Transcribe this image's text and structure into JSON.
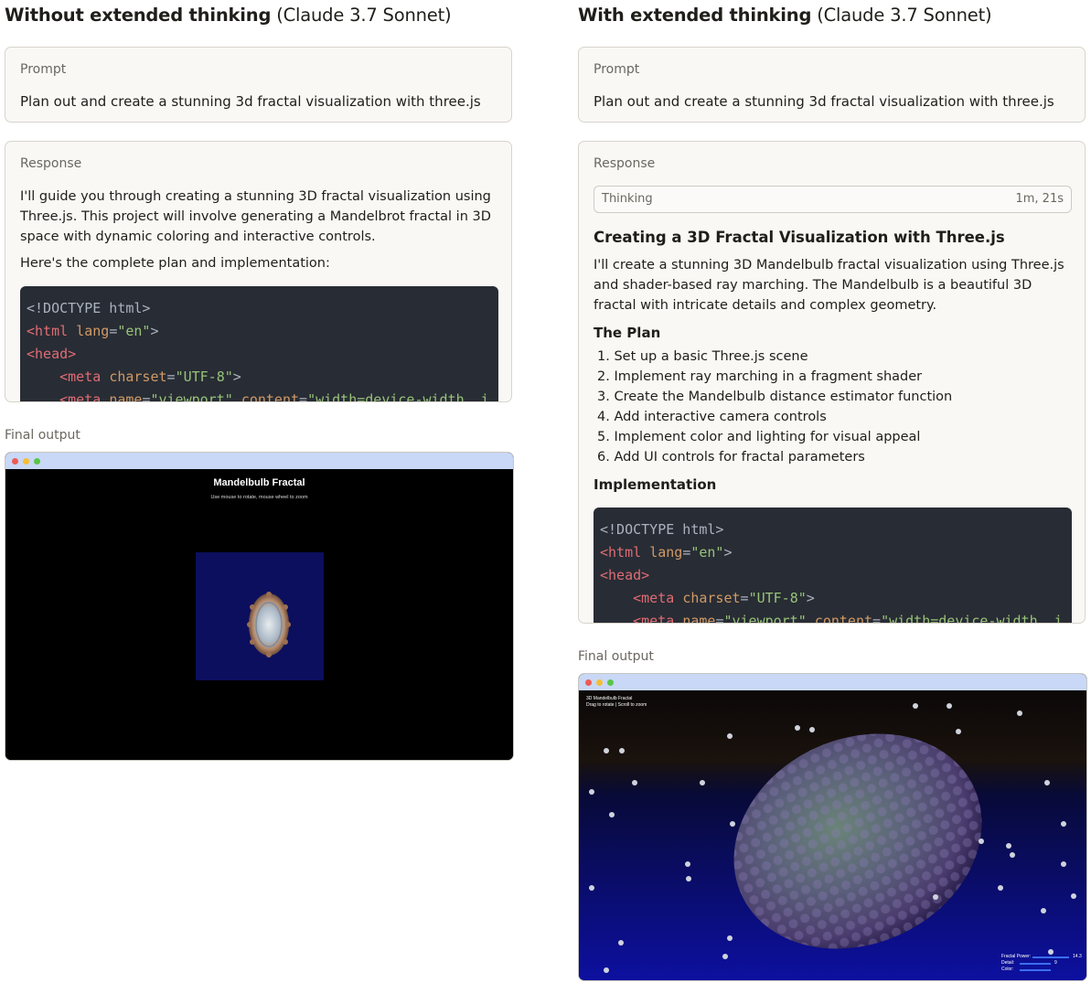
{
  "left": {
    "title_bold": "Without extended thinking",
    "title_sub": "(Claude 3.7 Sonnet)",
    "prompt_label": "Prompt",
    "prompt_text": "Plan out and create a stunning 3d fractal visualization with three.js",
    "response_label": "Response",
    "response_p1": "I'll guide you through creating a stunning 3D fractal visualization using Three.js. This project will involve generating a Mandelbrot fractal in 3D space with dynamic coloring and interactive controls.",
    "response_p2": "Here's the complete plan and implementation:",
    "final_label": "Final output",
    "render": {
      "title": "Mandelbulb Fractal",
      "subtitle": "Use mouse to rotate, mouse wheel to zoom"
    }
  },
  "right": {
    "title_bold": "With extended thinking",
    "title_sub": "(Claude 3.7 Sonnet)",
    "prompt_label": "Prompt",
    "prompt_text": "Plan out and create a stunning 3d fractal visualization with three.js",
    "response_label": "Response",
    "thinking_label": "Thinking",
    "thinking_time": "1m, 21s",
    "heading": "Creating a 3D Fractal Visualization with Three.js",
    "intro": "I'll create a stunning 3D Mandelbulb fractal visualization using Three.js and shader-based ray marching. The Mandelbulb is a beautiful 3D fractal with intricate details and complex geometry.",
    "plan_heading": "The Plan",
    "plan_items": [
      "1. Set up a basic Three.js scene",
      "2. Implement ray marching in a fragment shader",
      "3. Create the Mandelbulb distance estimator function",
      "4. Add interactive camera controls",
      "5. Implement color and lighting for visual appeal",
      "6. Add UI controls for fractal parameters"
    ],
    "impl_heading": "Implementation",
    "final_label": "Final output",
    "render": {
      "title": "3D Mandelbulb Fractal",
      "subtitle": "Drag to rotate | Scroll to zoom",
      "controls": [
        {
          "label": "Fractal Power:",
          "value": "14.3"
        },
        {
          "label": "Detail:",
          "value": "9"
        },
        {
          "label": "Color:",
          "value": ""
        }
      ]
    }
  },
  "code": {
    "doctype": "<!DOCTYPE html>",
    "html_open": "<html",
    "lang_attr": "lang",
    "lang_val": "\"en\"",
    "close": ">",
    "head_open": "<head>",
    "meta": "<meta",
    "charset_attr": "charset",
    "charset_val": "\"UTF-8\"",
    "name_attr": "name",
    "name_val": "\"viewport\"",
    "content_attr": "content",
    "content_val": "\"width=device-width, i"
  },
  "colors": {
    "card_bg": "#f9f8f5",
    "code_bg": "#282c34",
    "browser_bar": "#c9d8f7",
    "render_bg_left": "#000000",
    "render_square": "#0c0f5e"
  }
}
